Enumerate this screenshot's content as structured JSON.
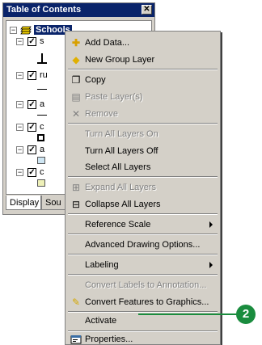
{
  "toc": {
    "title": "Table of Contents",
    "close_glyph": "✕",
    "group_name": "Schools",
    "layers": [
      {
        "label": "s",
        "check": "✓",
        "expander": "−"
      },
      {
        "label": "ru",
        "check": "✓",
        "expander": "−"
      },
      {
        "label": "a",
        "check": "✓",
        "expander": "−"
      },
      {
        "label": "c",
        "check": "✓",
        "expander": "−"
      },
      {
        "label": "a",
        "check": "✓",
        "expander": "−"
      },
      {
        "label": "c",
        "check": "✓",
        "expander": "−"
      }
    ],
    "group_expander": "−",
    "group_check": "✓",
    "tabs": {
      "display": "Display",
      "source": "Sou"
    }
  },
  "menu": {
    "items": [
      {
        "label": "Add Data...",
        "icon": "add-data-icon",
        "glyph": "✚",
        "color": "#c8a000",
        "disabled": false
      },
      {
        "label": "New Group Layer",
        "icon": "group-layer-icon",
        "glyph": "◆",
        "color": "#e0b000",
        "disabled": false
      },
      {
        "label": "Copy",
        "icon": "copy-icon",
        "glyph": "❐",
        "color": "#000000",
        "disabled": false
      },
      {
        "label": "Paste Layer(s)",
        "icon": "paste-icon",
        "glyph": "▤",
        "color": "#808080",
        "disabled": true
      },
      {
        "label": "Remove",
        "icon": "remove-icon",
        "glyph": "✕",
        "color": "#808080",
        "disabled": true
      },
      {
        "label": "Turn All Layers On",
        "disabled": true
      },
      {
        "label": "Turn All Layers Off",
        "disabled": false
      },
      {
        "label": "Select All Layers",
        "disabled": false
      },
      {
        "label": "Expand All Layers",
        "icon": "expand-icon",
        "glyph": "⊞",
        "color": "#808080",
        "disabled": true
      },
      {
        "label": "Collapse All Layers",
        "icon": "collapse-icon",
        "glyph": "⊟",
        "color": "#000000",
        "disabled": false
      },
      {
        "label": "Reference Scale",
        "submenu": true,
        "disabled": false
      },
      {
        "label": "Advanced Drawing Options...",
        "disabled": false
      },
      {
        "label": "Labeling",
        "submenu": true,
        "disabled": false
      },
      {
        "label": "Convert Labels to Annotation...",
        "disabled": true
      },
      {
        "label": "Convert Features to Graphics...",
        "icon": "convert-icon",
        "glyph": "✎",
        "color": "#d4a800",
        "disabled": false
      },
      {
        "label": "Activate",
        "disabled": false
      },
      {
        "label": "Properties...",
        "icon": "properties-icon",
        "glyph": "▣",
        "color": "#3a6ea5",
        "disabled": false
      }
    ]
  },
  "callout": {
    "number": "2",
    "color": "#1a8c3e"
  }
}
